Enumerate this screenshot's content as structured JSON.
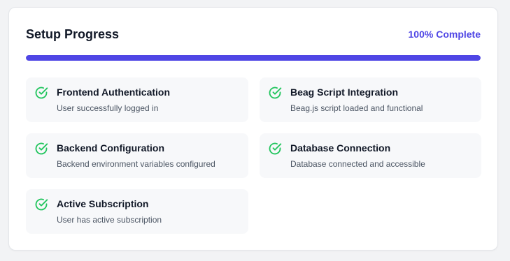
{
  "setup": {
    "title": "Setup Progress",
    "complete_label": "100% Complete",
    "progress_fraction": 1.0,
    "colors": {
      "accent": "#4f46e5",
      "check": "#22c55e"
    }
  },
  "steps": [
    {
      "title": "Frontend Authentication",
      "description": "User successfully logged in",
      "icon": "check-circle-icon",
      "status": "complete"
    },
    {
      "title": "Beag Script Integration",
      "description": "Beag.js script loaded and functional",
      "icon": "check-circle-icon",
      "status": "complete"
    },
    {
      "title": "Backend Configuration",
      "description": "Backend environment variables configured",
      "icon": "check-circle-icon",
      "status": "complete"
    },
    {
      "title": "Database Connection",
      "description": "Database connected and accessible",
      "icon": "check-circle-icon",
      "status": "complete"
    },
    {
      "title": "Active Subscription",
      "description": "User has active subscription",
      "icon": "check-circle-icon",
      "status": "complete"
    }
  ]
}
